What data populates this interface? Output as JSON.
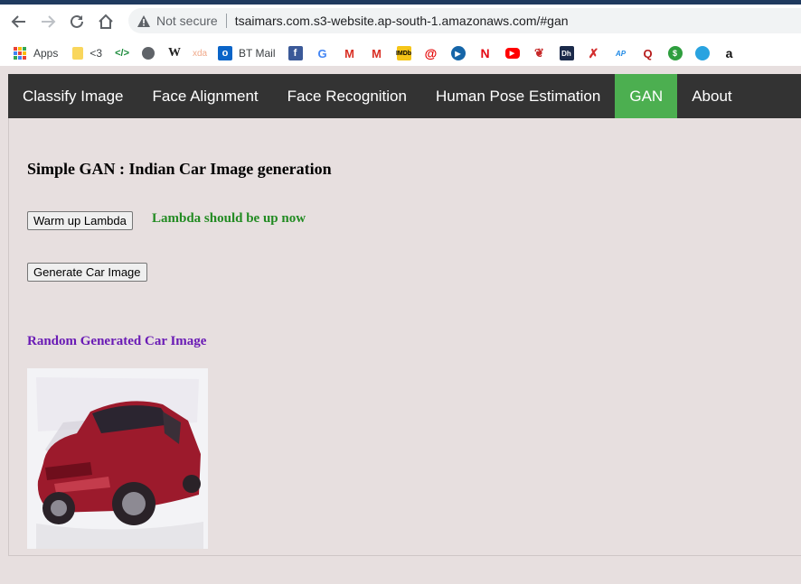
{
  "browser": {
    "security_label": "Not secure",
    "url": "tsaimars.com.s3-website.ap-south-1.amazonaws.com/#gan",
    "bookmarks": [
      {
        "icon": "apps-grid-icon",
        "label": "Apps"
      },
      {
        "icon": "folder-icon",
        "label": "<3"
      },
      {
        "icon": "code-tag-icon",
        "label": ""
      },
      {
        "icon": "globe-icon",
        "label": ""
      },
      {
        "icon": "wikipedia-icon",
        "label": ""
      },
      {
        "icon": "xda-icon",
        "label": ""
      },
      {
        "icon": "outlook-icon",
        "label": "BT Mail"
      },
      {
        "icon": "facebook-icon",
        "label": ""
      },
      {
        "icon": "google-icon",
        "label": ""
      },
      {
        "icon": "gmail-icon",
        "label": ""
      },
      {
        "icon": "gmail-icon",
        "label": ""
      },
      {
        "icon": "imdb-icon",
        "label": ""
      },
      {
        "icon": "airtel-icon",
        "label": ""
      },
      {
        "icon": "play-icon",
        "label": ""
      },
      {
        "icon": "netflix-icon",
        "label": ""
      },
      {
        "icon": "youtube-icon",
        "label": ""
      },
      {
        "icon": "feather-icon",
        "label": ""
      },
      {
        "icon": "dh-icon",
        "label": ""
      },
      {
        "icon": "cross-icon",
        "label": ""
      },
      {
        "icon": "ap-icon",
        "label": ""
      },
      {
        "icon": "q-icon",
        "label": ""
      },
      {
        "icon": "dollar-icon",
        "label": ""
      },
      {
        "icon": "sphere-icon",
        "label": ""
      },
      {
        "icon": "amazon-icon",
        "label": ""
      }
    ]
  },
  "nav": {
    "items": [
      "Classify Image",
      "Face Alignment",
      "Face Recognition",
      "Human Pose Estimation",
      "GAN",
      "About"
    ],
    "active": "GAN"
  },
  "main": {
    "heading": "Simple GAN : Indian Car Image generation",
    "warmup_button": "Warm up Lambda",
    "status": "Lambda should be up now",
    "generate_button": "Generate Car Image",
    "result_heading": "Random Generated Car Image"
  },
  "colors": {
    "nav_bg": "#333333",
    "nav_active": "#4caf50",
    "status": "#228b22",
    "result_heading": "#6a1bb5",
    "page_bg": "#e7dfdf"
  }
}
